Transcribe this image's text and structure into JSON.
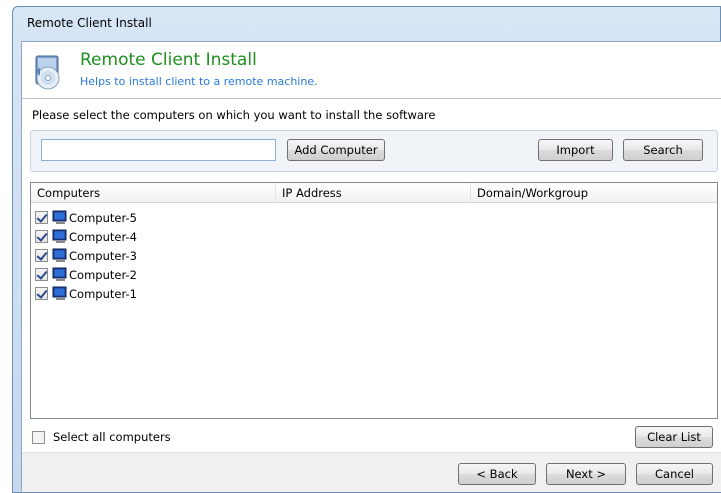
{
  "window": {
    "title": "Remote Client Install"
  },
  "header": {
    "title": "Remote Client Install",
    "subtitle": "Helps to install client to a remote machine."
  },
  "instruction": "Please select the computers on which you want to install the software",
  "toolbar": {
    "input_value": "",
    "add_computer_label": "Add Computer",
    "import_label": "Import",
    "search_label": "Search"
  },
  "list": {
    "columns": [
      "Computers",
      "IP Address",
      "Domain/Workgroup"
    ],
    "rows": [
      {
        "name": "Computer-5",
        "checked": true
      },
      {
        "name": "Computer-4",
        "checked": true
      },
      {
        "name": "Computer-3",
        "checked": true
      },
      {
        "name": "Computer-2",
        "checked": true
      },
      {
        "name": "Computer-1",
        "checked": true
      }
    ]
  },
  "select_all": {
    "label": "Select all computers",
    "checked": false
  },
  "clear_list_label": "Clear List",
  "footer": {
    "back_label": "< Back",
    "next_label": "Next >",
    "cancel_label": "Cancel"
  },
  "colors": {
    "header_title": "#1f8f1f",
    "header_subtitle": "#2a7ad8",
    "window_frame": "#c5d8ee"
  },
  "icons": {
    "header": "install-disc-box-icon",
    "row": "computer-icon"
  }
}
